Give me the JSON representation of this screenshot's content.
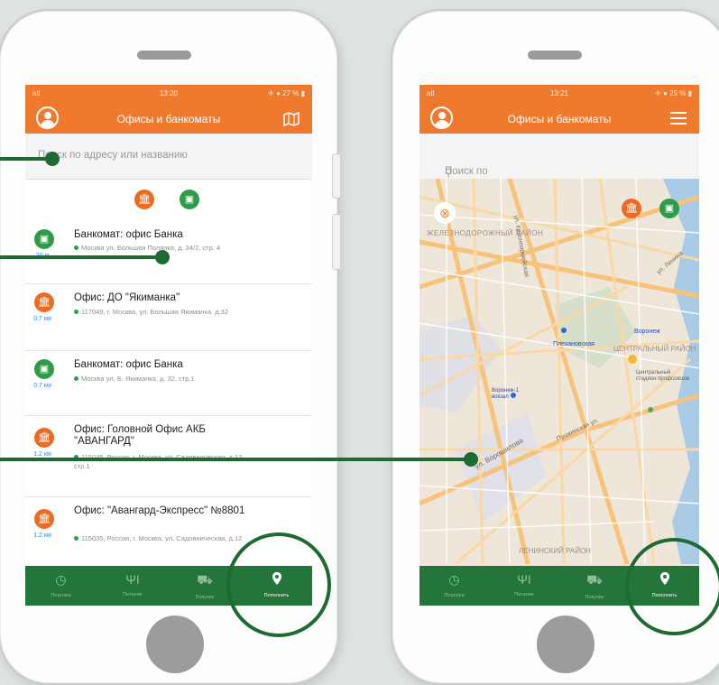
{
  "left_screen": {
    "status": {
      "signal": "atl",
      "time": "13:20",
      "battery": "✈ ● 27 % ▮"
    },
    "title": "Офисы и банкоматы",
    "search_placeholder": "Поиск по адресу или названию",
    "items": [
      {
        "type": "atm",
        "distance": "20 м",
        "title": "Банкомат: офис Банка",
        "address": "Москва ул. Большая Полянка, д. 34/2, стр. 4"
      },
      {
        "type": "office",
        "distance": "0.7 км",
        "title": "Офис: ДО \"Якиманка\"",
        "address": "117049, г. Москва, ул. Большая Якиманка, д.32"
      },
      {
        "type": "atm",
        "distance": "0.7 км",
        "title": "Банкомат: офис Банка",
        "address": "Москва ул. Б. Якиманка, д. 32, стр.1"
      },
      {
        "type": "office",
        "distance": "1.2 км",
        "title": "Офис: Головной Офис АКБ \"АВАНГАРД\"",
        "address": "115035, Россия, г. Москва, ул. Садовническая, д.12 стр.1"
      },
      {
        "type": "office",
        "distance": "1.2 км",
        "title": "Офис: \"Авангард-Экспресс\" №8801",
        "address": "115035, Россия, г. Москва, ул. Садовническая, д.12"
      }
    ]
  },
  "right_screen": {
    "status": {
      "signal": "atl",
      "time": "13:21",
      "battery": "✈ ● 25 % ▮"
    },
    "title": "Офисы и банкоматы",
    "search_placeholder": "Поиск по адресу или названию",
    "map_labels": {
      "district_north": "ЖЕЛЕЗНОДОРОЖНЫЙ РАЙОН",
      "district_center": "ЦЕНТРАЛЬНЫЙ РАЙОН",
      "district_south": "ЛЕНИНСКИЙ РАЙОН",
      "street_voroshilova": "ул. Ворошилова",
      "street_pushkinskaya": "Пушкинская ул.",
      "street_lenina": "ул. Ленина",
      "street_krasnoarmeyskaya": "ул. Красноармейская",
      "place_voronezh": "Воронеж",
      "place_plekhanovskaya": "Плехановская",
      "place_center": "Центральный стадион профсоюзов",
      "place_station": "Воронеж-1 вокзал"
    }
  },
  "tabs": [
    {
      "icon": "clock-icon",
      "glyph": "◷",
      "label": "Платежи"
    },
    {
      "icon": "fork-knife-icon",
      "glyph": "ΨΙ",
      "label": "Питание"
    },
    {
      "icon": "cart-icon",
      "glyph": "⛟",
      "label": "Покупки"
    },
    {
      "icon": "pin-icon",
      "glyph": "⬤",
      "label": "Пополнить"
    }
  ],
  "colors": {
    "brand_orange": "#ef7a2d",
    "brand_green": "#23753a",
    "callout_green": "#1e6a32"
  }
}
